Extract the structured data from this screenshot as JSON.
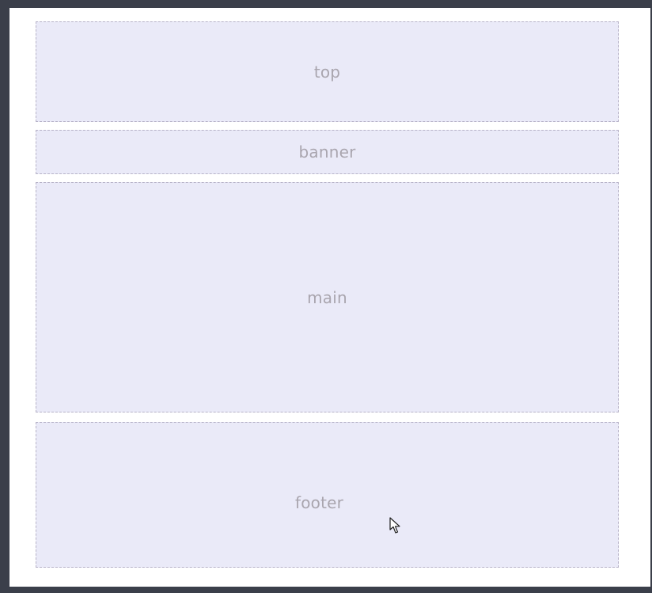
{
  "sections": {
    "top": {
      "label": "top"
    },
    "banner": {
      "label": "banner"
    },
    "main": {
      "label": "main"
    },
    "footer": {
      "label": "footer"
    }
  },
  "icons": {
    "cursor": "mouse-pointer-icon"
  },
  "colors": {
    "page_background": "#3b3f4a",
    "canvas_background": "#ffffff",
    "block_fill": "#eaeaf8",
    "block_border": "#b7b3c8",
    "label_text": "#a9a5ae"
  }
}
